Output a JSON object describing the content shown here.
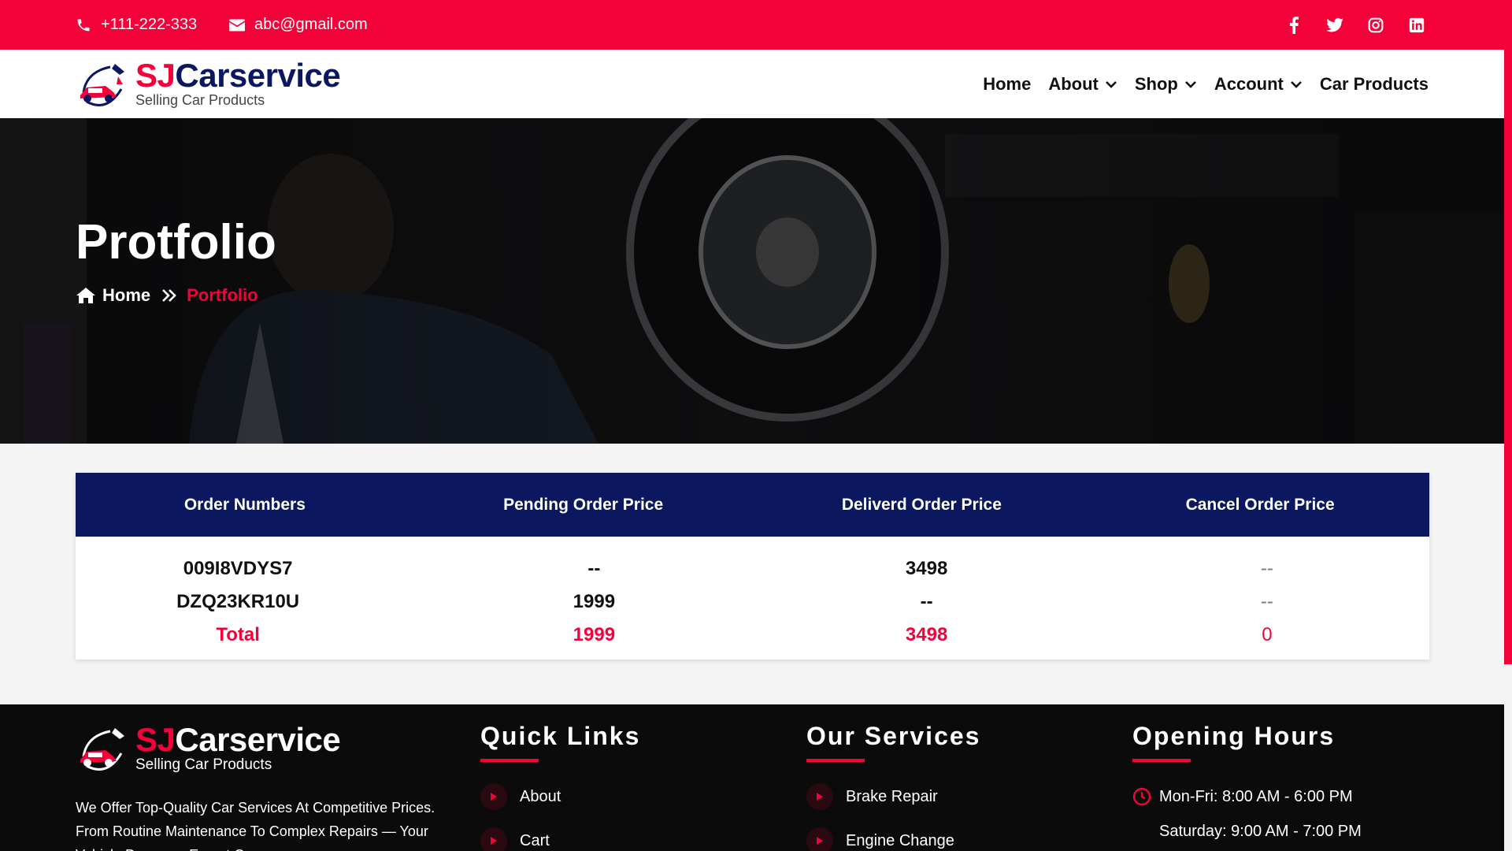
{
  "topbar": {
    "phone": "+111-222-333",
    "email": "abc@gmail.com",
    "social": [
      "facebook-icon",
      "twitter-icon",
      "instagram-icon",
      "linkedin-icon"
    ]
  },
  "brand": {
    "name_part1": "SJ",
    "name_part2": "Carservice",
    "tagline": "Selling Car Products"
  },
  "nav": {
    "home": "Home",
    "about": "About",
    "shop": "Shop",
    "account": "Account",
    "car_products": "Car Products"
  },
  "hero": {
    "title": "Protfolio",
    "breadcrumb_home": "Home",
    "breadcrumb_current": "Portfolio"
  },
  "table": {
    "headers": [
      "Order Numbers",
      "Pending Order Price",
      "Deliverd Order Price",
      "Cancel Order Price"
    ],
    "rows": [
      [
        "009I8VDYS7",
        "--",
        "3498",
        "--"
      ],
      [
        "DZQ23KR10U",
        "1999",
        "--",
        "--"
      ]
    ],
    "total": [
      "Total",
      "1999",
      "3498",
      "0"
    ]
  },
  "footer": {
    "description": "We Offer Top-Quality Car Services At Competitive Prices. From Routine Maintenance To Complex Repairs — Your Vehicle Deserves Expert Care.",
    "quick_links": {
      "title": "Quick Links",
      "items": [
        "About",
        "Cart"
      ]
    },
    "services": {
      "title": "Our Services",
      "items": [
        "Brake Repair",
        "Engine Change"
      ]
    },
    "hours": {
      "title": "Opening Hours",
      "items": [
        "Mon-Fri: 8:00 AM - 6:00 PM",
        "Saturday: 9:00 AM - 7:00 PM"
      ]
    }
  },
  "colors": {
    "accent": "#f4013a",
    "navy": "#0b1860",
    "footer_bg": "#0b0b0c"
  }
}
